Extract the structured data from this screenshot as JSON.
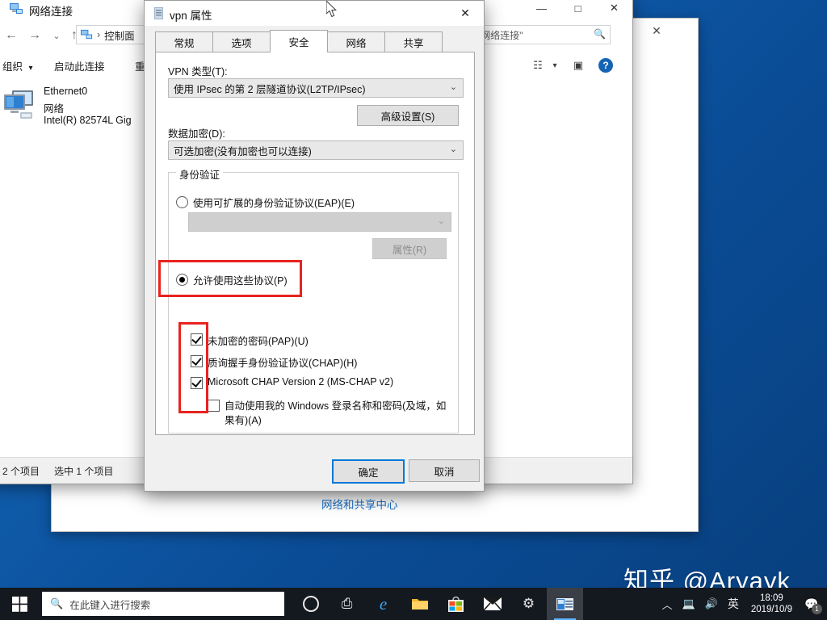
{
  "desktop": {
    "watermark": "知乎 @Aryayk"
  },
  "window_back": {
    "link_label": "网络和共享中心",
    "buttons": {
      "maximize": "□",
      "close": "✕"
    }
  },
  "explorer": {
    "title": "网络连接",
    "title_icon": "network-connections-icon",
    "window_buttons": {
      "minimize": "—",
      "maximize": "□",
      "close": "✕"
    },
    "nav": {
      "back": "←",
      "forward": "→",
      "recent": "⌄",
      "up": "↑",
      "breadcrumb": "控制面",
      "breadcrumb_separator": "›"
    },
    "search": {
      "value": "搜索\"网络连接\"",
      "icon": "search-icon"
    },
    "command_bar": {
      "organize": "组织",
      "organize_arrow": "▾",
      "start_connection": "启动此连接",
      "third_item": "重",
      "view_icon": "view-layout-icon",
      "view_arrow": "▾",
      "pane_icon": "preview-pane-icon",
      "help_icon": "help-icon",
      "help_glyph": "?"
    },
    "items": [
      {
        "name": "Ethernet0",
        "type": "网络",
        "adapter": "Intel(R) 82574L Gig"
      }
    ],
    "status": {
      "count": "2 个项目",
      "selected": "选中 1 个项目"
    }
  },
  "dialog": {
    "title": "vpn 属性",
    "title_icon": "vpn-properties-icon",
    "close_label": "✕",
    "tabs": [
      {
        "label": "常规",
        "active": false
      },
      {
        "label": "选项",
        "active": false
      },
      {
        "label": "安全",
        "active": true
      },
      {
        "label": "网络",
        "active": false
      },
      {
        "label": "共享",
        "active": false
      }
    ],
    "vpn_type": {
      "label": "VPN 类型(T):",
      "value": "使用 IPsec 的第 2 层隧道协议(L2TP/IPsec)",
      "arrow": "⌄"
    },
    "advanced_button": "高级设置(S)",
    "data_encryption": {
      "label": "数据加密(D):",
      "value": "可选加密(没有加密也可以连接)",
      "arrow": "⌄"
    },
    "auth_group": {
      "legend": "身份验证",
      "eap_radio": {
        "label": "使用可扩展的身份验证协议(EAP)(E)",
        "selected": false
      },
      "eap_combo": {
        "value": "",
        "arrow": "⌄",
        "disabled": true
      },
      "eap_properties_button": {
        "label": "属性(R)",
        "disabled": true
      },
      "protocols_radio": {
        "label": "允许使用这些协议(P)",
        "selected": true
      },
      "protocols": [
        {
          "label": "未加密的密码(PAP)(U)",
          "checked": true
        },
        {
          "label": "质询握手身份验证协议(CHAP)(H)",
          "checked": true
        },
        {
          "label": "Microsoft CHAP Version 2 (MS-CHAP v2)",
          "checked": true
        },
        {
          "label": "自动使用我的 Windows 登录名称和密码(及域，如果有)(A)",
          "checked": false
        }
      ]
    },
    "ok_button": "确定",
    "cancel_button": "取消",
    "annotation_color": "#e8231f"
  },
  "taskbar": {
    "start_icon": "windows-start-icon",
    "search_placeholder": "在此键入进行搜索",
    "search_icon": "search-icon",
    "cortana_icon": "cortana-icon",
    "taskview_icon": "task-view-icon",
    "apps": [
      {
        "name": "edge-icon",
        "glyph": "e",
        "active": false
      },
      {
        "name": "file-explorer-icon",
        "glyph": "🗂",
        "active": false
      },
      {
        "name": "microsoft-store-icon",
        "glyph": "🛍",
        "active": false
      },
      {
        "name": "mail-icon",
        "glyph": "✉",
        "active": false
      },
      {
        "name": "settings-icon",
        "glyph": "⚙",
        "active": false
      },
      {
        "name": "network-connections-icon",
        "glyph": "🖧",
        "active": true
      }
    ],
    "tray": {
      "chevron": "︿",
      "network_icon": "network-icon",
      "volume_icon": "volume-icon",
      "ime": "英",
      "time": "18:09",
      "date": "2019/10/9",
      "notification_icon": "notification-icon",
      "notification_count": "1"
    }
  }
}
